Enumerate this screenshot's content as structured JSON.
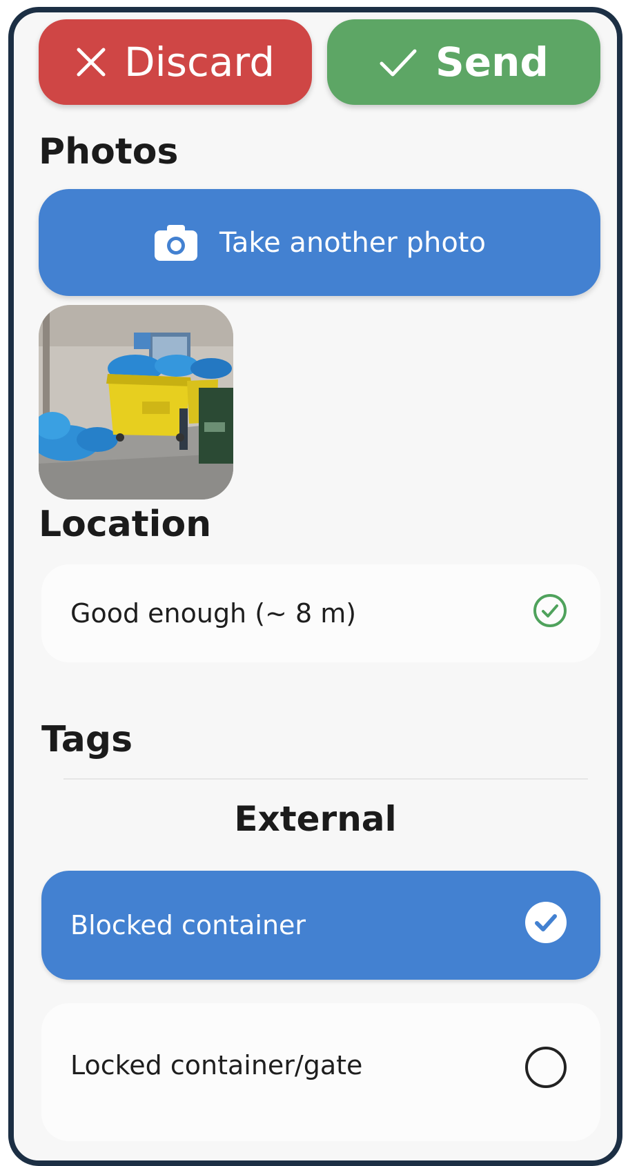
{
  "actions": {
    "discard_label": "Discard",
    "send_label": "Send"
  },
  "photos": {
    "title": "Photos",
    "take_photo_label": "Take another photo"
  },
  "location": {
    "title": "Location",
    "status": "Good enough (~ 8 m)",
    "status_icon": "check-circle-outline-icon"
  },
  "tags": {
    "title": "Tags",
    "group_title": "External",
    "items": [
      {
        "label": "Blocked container",
        "selected": true
      },
      {
        "label": "Locked container/gate",
        "selected": false
      }
    ]
  },
  "colors": {
    "discard": "#cf4645",
    "send": "#5da665",
    "primary": "#4381d1",
    "frame": "#1c2f44"
  }
}
